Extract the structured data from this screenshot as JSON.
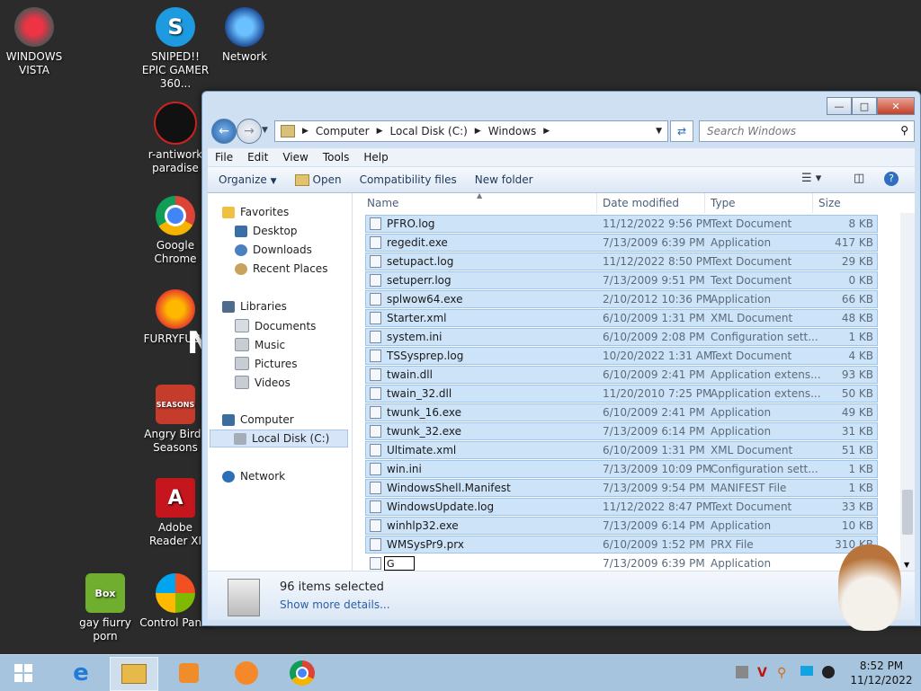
{
  "desktop": {
    "icons": [
      {
        "label": "WINDOWS VISTA"
      },
      {
        "label": "SNIPED!! EPIC GAMER 360..."
      },
      {
        "label": "Network"
      },
      {
        "label": "r-antiwork paradise"
      },
      {
        "label": "Google Chrome"
      },
      {
        "label": "FURRYFUCK"
      },
      {
        "label": "Angry Birds Seasons"
      },
      {
        "label": "Adobe Reader XI"
      },
      {
        "label": "gay fiurry porn"
      },
      {
        "label": "Control Panel"
      }
    ],
    "overlay_letter": "N"
  },
  "window": {
    "controls": {
      "minimize": "—",
      "maximize": "□",
      "close": "✕"
    },
    "address": {
      "crumbs": [
        "Computer",
        "Local Disk (C:)",
        "Windows"
      ]
    },
    "search_placeholder": "Search Windows",
    "menu": [
      "File",
      "Edit",
      "View",
      "Tools",
      "Help"
    ],
    "toolbar": {
      "organize": "Organize",
      "open": "Open",
      "compat": "Compatibility files",
      "new_folder": "New folder"
    },
    "nav": {
      "favorites": "Favorites",
      "fav_items": [
        "Desktop",
        "Downloads",
        "Recent Places"
      ],
      "libraries": "Libraries",
      "lib_items": [
        "Documents",
        "Music",
        "Pictures",
        "Videos"
      ],
      "computer": "Computer",
      "computer_items": [
        "Local Disk (C:)"
      ],
      "network": "Network"
    },
    "columns": [
      "Name",
      "Date modified",
      "Type",
      "Size"
    ],
    "files": [
      {
        "name": "PFRO.log",
        "date": "11/12/2022 9:56 PM",
        "type": "Text Document",
        "size": "8 KB"
      },
      {
        "name": "regedit.exe",
        "date": "7/13/2009 6:39 PM",
        "type": "Application",
        "size": "417 KB"
      },
      {
        "name": "setupact.log",
        "date": "11/12/2022 8:50 PM",
        "type": "Text Document",
        "size": "29 KB"
      },
      {
        "name": "setuperr.log",
        "date": "7/13/2009 9:51 PM",
        "type": "Text Document",
        "size": "0 KB"
      },
      {
        "name": "splwow64.exe",
        "date": "2/10/2012 10:36 PM",
        "type": "Application",
        "size": "66 KB"
      },
      {
        "name": "Starter.xml",
        "date": "6/10/2009 1:31 PM",
        "type": "XML Document",
        "size": "48 KB"
      },
      {
        "name": "system.ini",
        "date": "6/10/2009 2:08 PM",
        "type": "Configuration sett...",
        "size": "1 KB"
      },
      {
        "name": "TSSysprep.log",
        "date": "10/20/2022 1:31 AM",
        "type": "Text Document",
        "size": "4 KB"
      },
      {
        "name": "twain.dll",
        "date": "6/10/2009 2:41 PM",
        "type": "Application extens...",
        "size": "93 KB"
      },
      {
        "name": "twain_32.dll",
        "date": "11/20/2010 7:25 PM",
        "type": "Application extens...",
        "size": "50 KB"
      },
      {
        "name": "twunk_16.exe",
        "date": "6/10/2009 2:41 PM",
        "type": "Application",
        "size": "49 KB"
      },
      {
        "name": "twunk_32.exe",
        "date": "7/13/2009 6:14 PM",
        "type": "Application",
        "size": "31 KB"
      },
      {
        "name": "Ultimate.xml",
        "date": "6/10/2009 1:31 PM",
        "type": "XML Document",
        "size": "51 KB"
      },
      {
        "name": "win.ini",
        "date": "7/13/2009 10:09 PM",
        "type": "Configuration sett...",
        "size": "1 KB"
      },
      {
        "name": "WindowsShell.Manifest",
        "date": "7/13/2009 9:54 PM",
        "type": "MANIFEST File",
        "size": "1 KB"
      },
      {
        "name": "WindowsUpdate.log",
        "date": "11/12/2022 8:47 PM",
        "type": "Text Document",
        "size": "33 KB"
      },
      {
        "name": "winhlp32.exe",
        "date": "7/13/2009 6:14 PM",
        "type": "Application",
        "size": "10 KB"
      },
      {
        "name": "WMSysPr9.prx",
        "date": "6/10/2009 1:52 PM",
        "type": "PRX File",
        "size": "310 KB"
      }
    ],
    "rename_row": {
      "value": "G",
      "date": "7/13/2009 6:39 PM",
      "type": "Application"
    },
    "details": {
      "count": "96 items selected",
      "more": "Show more details..."
    }
  },
  "taskbar": {
    "clock_time": "8:52 PM",
    "clock_date": "11/12/2022",
    "tray_letter": "V"
  }
}
